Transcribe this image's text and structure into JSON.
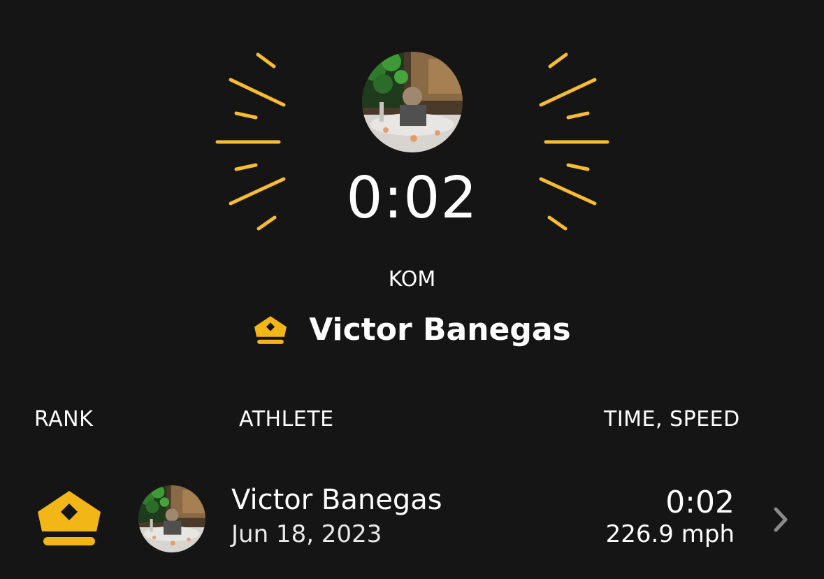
{
  "colors": {
    "background": "#151515",
    "accent": "#f2b616",
    "ray": "#f7bb34",
    "text": "#ffffff",
    "chevron": "#8a8a8a"
  },
  "hero": {
    "time": "0:02",
    "avatar_icon": "athlete-avatar-photo"
  },
  "kom": {
    "label": "KOM",
    "leader_name": "Victor Banegas",
    "crown_icon": "crown-icon"
  },
  "table": {
    "headers": {
      "rank": "RANK",
      "athlete": "ATHLETE",
      "time_speed": "TIME, SPEED"
    },
    "rows": [
      {
        "rank_icon": "crown-icon",
        "athlete_name": "Victor Banegas",
        "date": "Jun 18, 2023",
        "time": "0:02",
        "speed": "226.9 mph",
        "chevron_icon": "chevron-right-icon"
      }
    ]
  }
}
